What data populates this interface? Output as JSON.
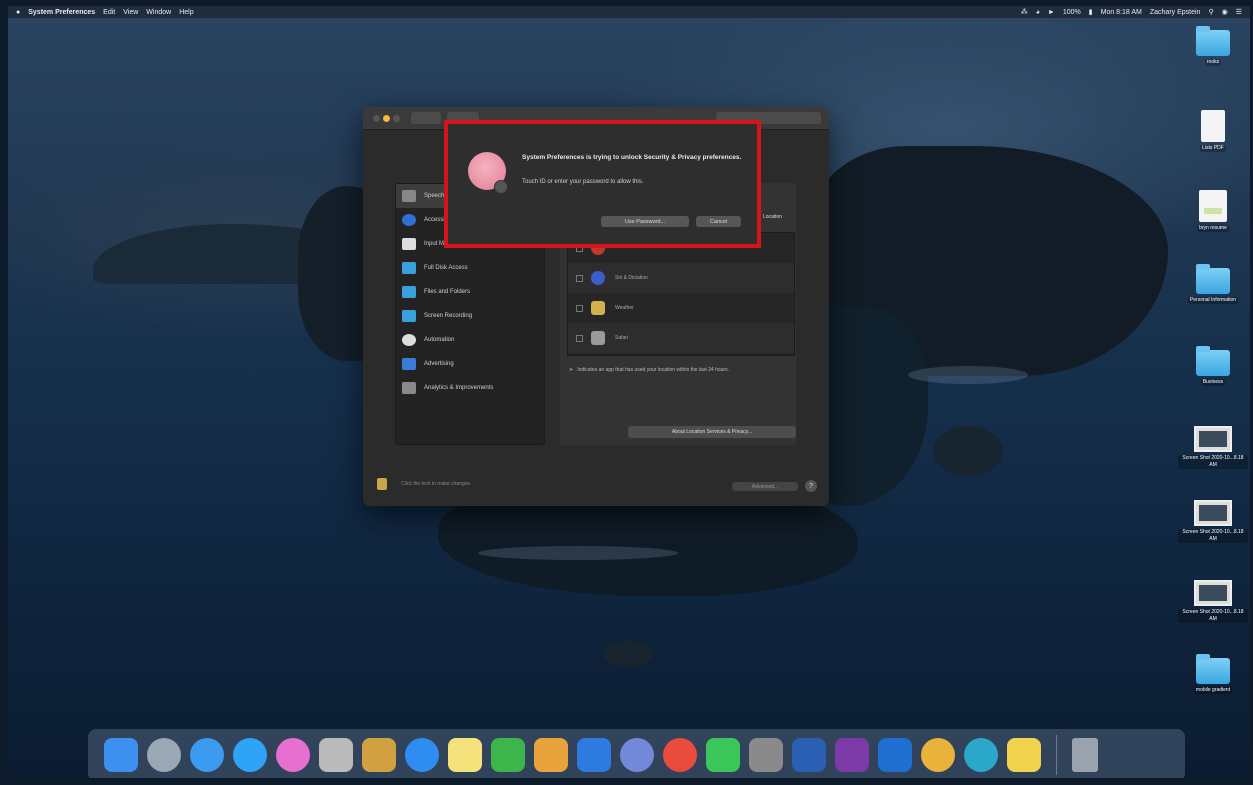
{
  "menubar": {
    "apple": "",
    "app_name": "System Preferences",
    "menus": [
      "Edit",
      "View",
      "Window",
      "Help"
    ],
    "status": {
      "battery": "100%",
      "clock": "Mon 8:18 AM",
      "user": "Zachary Epstein"
    }
  },
  "desktop": {
    "icons": [
      {
        "label": "rooks",
        "type": "folder"
      },
      {
        "label": "Lists PDF",
        "type": "doc"
      },
      {
        "label": "bryn resume",
        "type": "doc2"
      },
      {
        "label": "Personal Information",
        "type": "folder"
      },
      {
        "label": "Business",
        "type": "folder"
      },
      {
        "label": "Screen Shot 2020-10...8.18 AM",
        "type": "shot"
      },
      {
        "label": "Screen Shot 2020-10...8.18 AM",
        "type": "shot"
      },
      {
        "label": "Screen Shot 2020-10...8.18 AM",
        "type": "shot"
      },
      {
        "label": "mobile gradient",
        "type": "folder"
      }
    ]
  },
  "prefs_window": {
    "sidebar": [
      {
        "label": "Speech Recognition",
        "color": "#888888"
      },
      {
        "label": "Accessibility",
        "color": "#2f6fd6"
      },
      {
        "label": "Input Monitoring",
        "color": "#dddddd"
      },
      {
        "label": "Full Disk Access",
        "color": "#3aa0e0"
      },
      {
        "label": "Files and Folders",
        "color": "#3aa0e0"
      },
      {
        "label": "Screen Recording",
        "color": "#3aa0e0"
      },
      {
        "label": "Automation",
        "color": "#dddddd"
      },
      {
        "label": "Advertising",
        "color": "#3a7bd5"
      },
      {
        "label": "Analytics & Improvements",
        "color": "#8a8a8a"
      }
    ],
    "tabs_label": "Location",
    "apps": [
      {
        "label": "",
        "color": "#c0392b"
      },
      {
        "label": "Siri & Dictation",
        "color": "#3b5ec9"
      },
      {
        "label": "Weather",
        "color": "#d2b04c"
      },
      {
        "label": "Safari",
        "color": "#9a9a9a"
      }
    ],
    "location_note": "Indicates an app that has used your location within the last 24 hours.",
    "about_button": "About Location Services & Privacy...",
    "lock_text": "Click the lock to make changes.",
    "advanced_button": "Advanced...",
    "help_button": "?"
  },
  "auth_dialog": {
    "title": "System Preferences is trying to unlock Security & Privacy preferences.",
    "message": "Touch ID or enter your password to allow this.",
    "use_password": "Use Password...",
    "cancel": "Cancel"
  },
  "dock": {
    "apps": [
      {
        "name": "finder-icon",
        "color": "#3d8ff0"
      },
      {
        "name": "launchpad-icon",
        "color": "#9aa7b5"
      },
      {
        "name": "safari-icon",
        "color": "#3a9bf0"
      },
      {
        "name": "messages-icon",
        "color": "#2fa3f5"
      },
      {
        "name": "itunes-icon",
        "color": "#e66fd0"
      },
      {
        "name": "disk-utility-icon",
        "color": "#bbbbbb"
      },
      {
        "name": "cleaner-icon",
        "color": "#d1a040"
      },
      {
        "name": "app-store-icon",
        "color": "#2f8cf0"
      },
      {
        "name": "notes-icon",
        "color": "#f6e27a"
      },
      {
        "name": "numbers-icon",
        "color": "#3cb54a"
      },
      {
        "name": "pages-icon",
        "color": "#e8a33d"
      },
      {
        "name": "keynote-icon",
        "color": "#2d7ae0"
      },
      {
        "name": "discord-icon",
        "color": "#7289da"
      },
      {
        "name": "chrome-icon",
        "color": "#e94b3c"
      },
      {
        "name": "facetime-icon",
        "color": "#3bc65a"
      },
      {
        "name": "system-preferences-icon",
        "color": "#8a8a8a"
      },
      {
        "name": "word-icon",
        "color": "#2b5fb3"
      },
      {
        "name": "onenote-icon",
        "color": "#7b3aa8"
      },
      {
        "name": "outlook-icon",
        "color": "#1e6fd0"
      },
      {
        "name": "chrome-canary-icon",
        "color": "#e8b23b"
      },
      {
        "name": "browser-icon",
        "color": "#2aa7c9"
      },
      {
        "name": "stickies-icon",
        "color": "#f0d24d"
      },
      {
        "name": "trash-icon",
        "color": "#9aa3ad"
      }
    ]
  }
}
